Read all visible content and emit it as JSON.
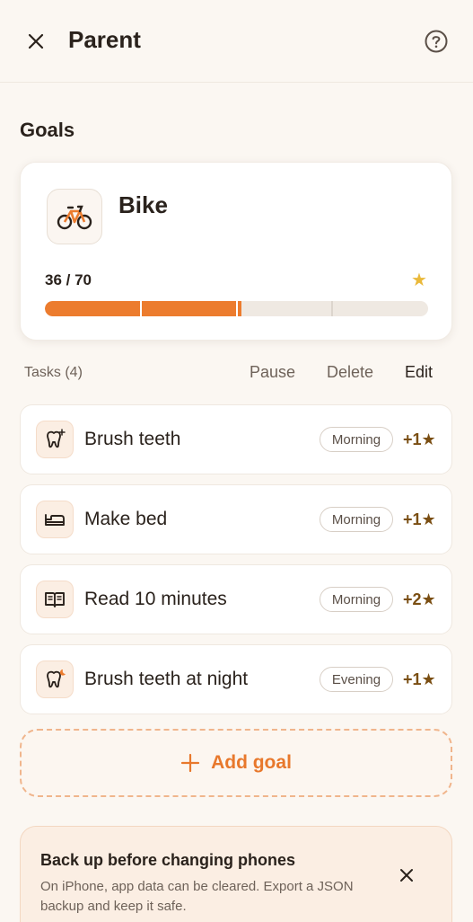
{
  "header": {
    "title": "Parent",
    "close_icon": "close-icon",
    "help_icon": "help-circle-icon"
  },
  "goals_section": {
    "title": "Goals"
  },
  "goal": {
    "name": "Bike",
    "icon": "bike-icon",
    "progress_text": "36 / 70",
    "current": 36,
    "target": 70,
    "progress_fraction": 0.514,
    "star_icon": "star-icon",
    "accent_color": "#ec7c2e",
    "star_color": "#eab93a"
  },
  "tasks_header": {
    "label": "Tasks (4)",
    "pause": "Pause",
    "delete": "Delete",
    "edit": "Edit"
  },
  "tasks": [
    {
      "title": "Brush teeth",
      "badge": "Morning",
      "points": "+1★",
      "icon": "tooth-sparkle-icon"
    },
    {
      "title": "Make bed",
      "badge": "Morning",
      "points": "+1★",
      "icon": "bed-icon"
    },
    {
      "title": "Read 10 minutes",
      "badge": "Morning",
      "points": "+2★",
      "icon": "book-icon"
    },
    {
      "title": "Brush teeth at night",
      "badge": "Evening",
      "points": "+1★",
      "icon": "tooth-moon-icon"
    }
  ],
  "add_goal": {
    "label": "Add goal",
    "icon": "plus-icon"
  },
  "backup_notice": {
    "title": "Back up before changing phones",
    "text": "On iPhone, app data can be cleared. Export a JSON backup and keep it safe.",
    "close_icon": "close-icon"
  }
}
